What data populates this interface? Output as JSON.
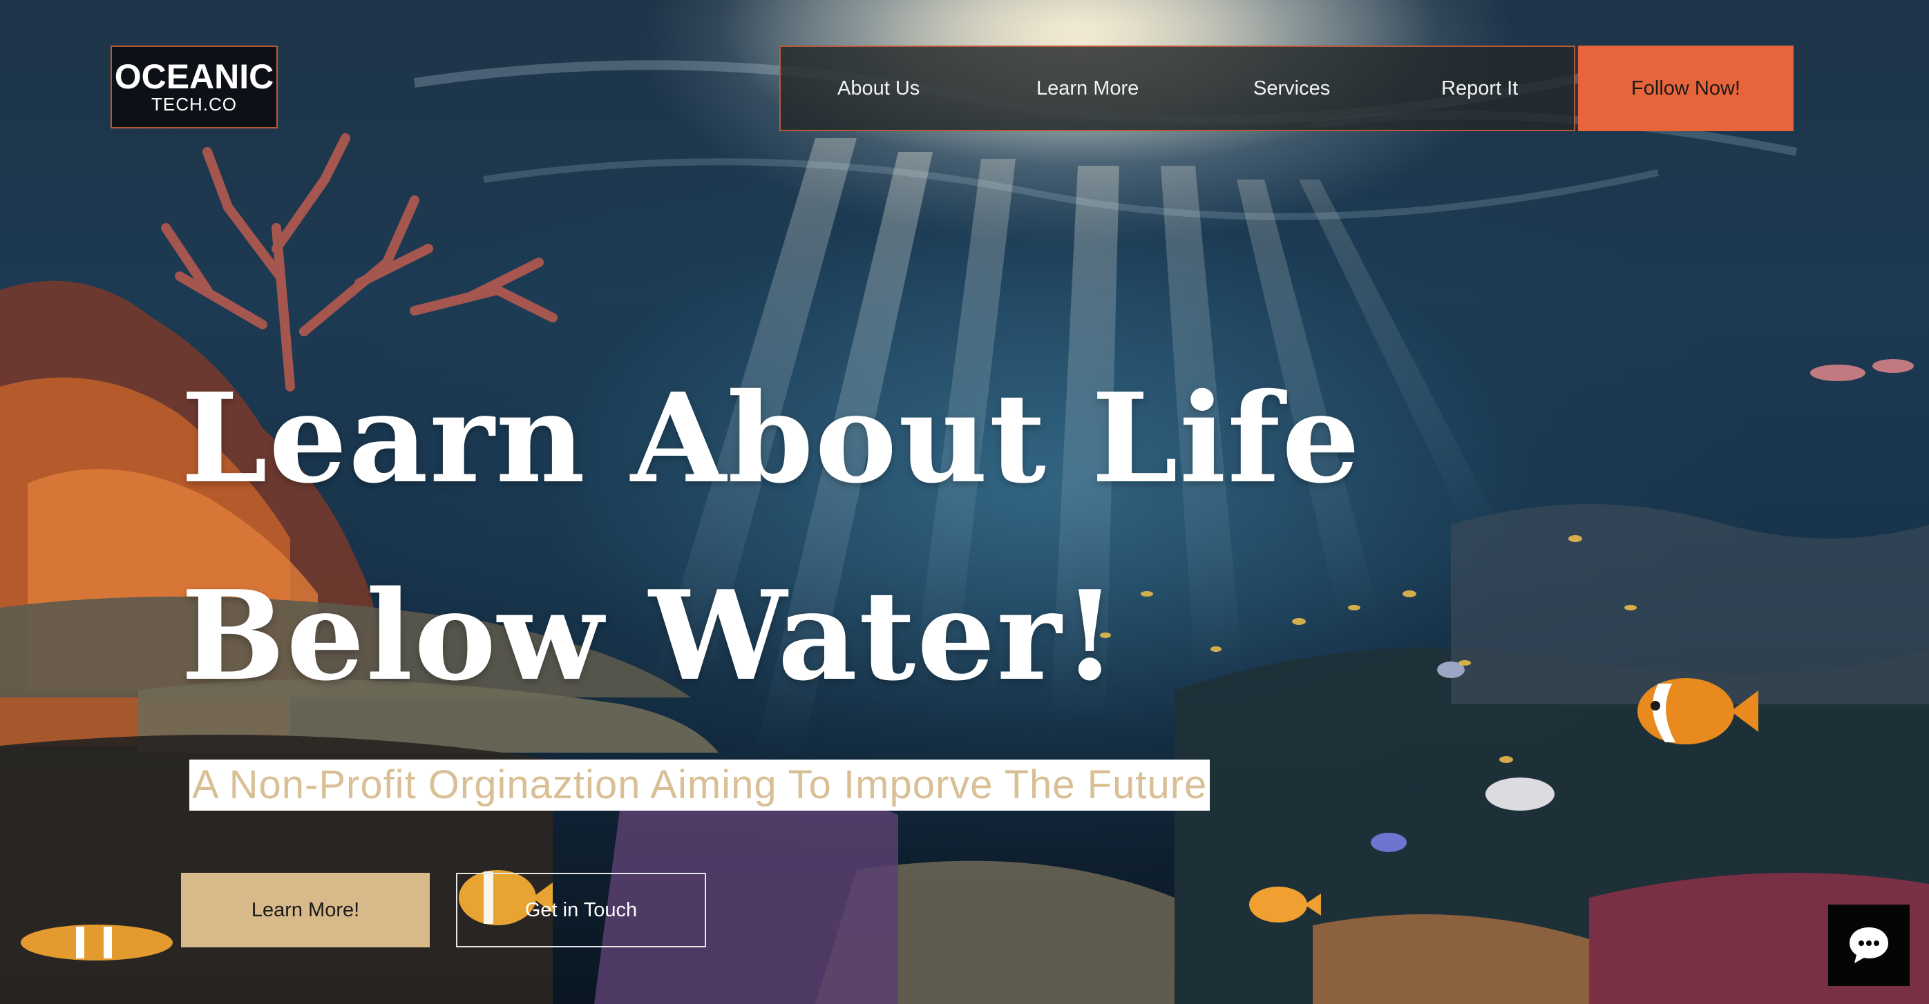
{
  "brand": {
    "name": "OCEANIC",
    "sub": "TECH.CO"
  },
  "nav": {
    "items": [
      {
        "label": "About Us"
      },
      {
        "label": "Learn More"
      },
      {
        "label": "Services"
      },
      {
        "label": "Report It"
      }
    ],
    "cta_label": "Follow Now!"
  },
  "hero": {
    "title_line1": "Learn About Life",
    "title_line2": "Below Water!",
    "subtitle": "A Non-Profit Orginaztion Aiming To Imporve The Future",
    "primary_button": "Learn More!",
    "secondary_button": "Get in Touch"
  },
  "chat": {
    "icon": "chat-bubble-icon"
  },
  "colors": {
    "accent": "#e8643a",
    "sand": "#d7b98a",
    "subtitle_text": "#d9bf95",
    "logo_border": "#b85a3a"
  }
}
